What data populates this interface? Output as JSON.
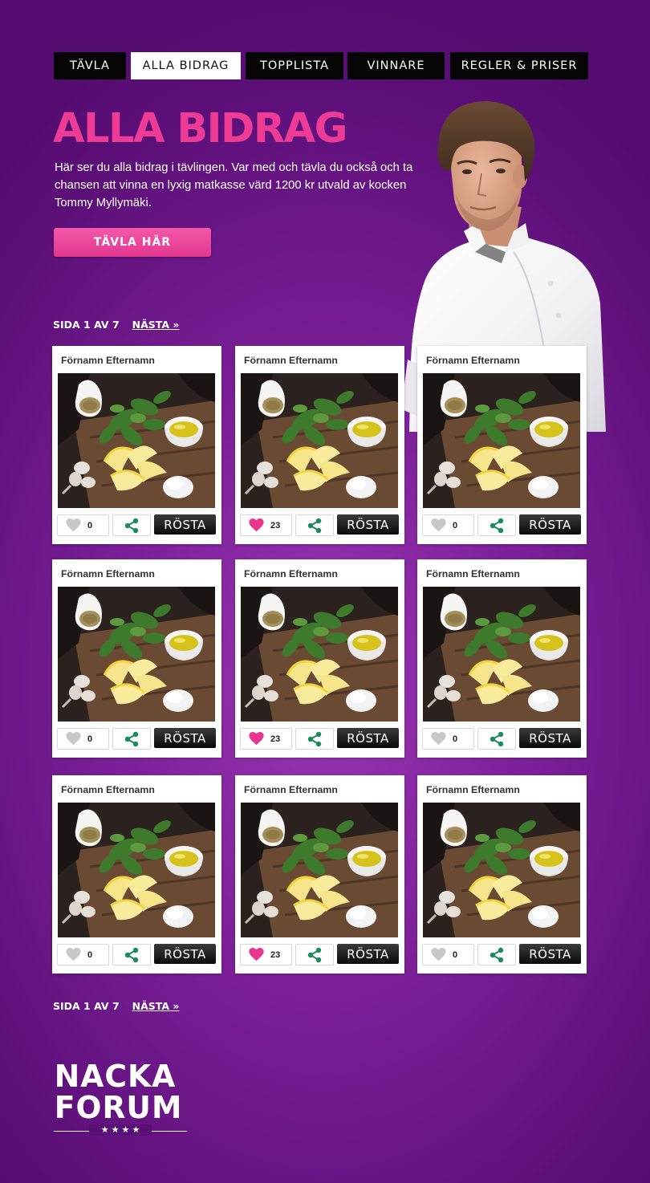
{
  "nav": {
    "tabs": [
      {
        "label": "TÄVLA",
        "active": false
      },
      {
        "label": "ALLA BIDRAG",
        "active": true
      },
      {
        "label": "TOPPLISTA",
        "active": false
      },
      {
        "label": "VINNARE",
        "active": false
      },
      {
        "label": "REGLER & PRISER",
        "active": false
      }
    ]
  },
  "hero": {
    "title": "ALLA BIDRAG",
    "description": "Här ser du alla bidrag i tävlingen. Var med och tävla du också och ta chansen att vinna en lyxig matkasse värd 1200 kr utvald av kocken Tommy Myllymäki.",
    "cta_label": "TÄVLA HÄR"
  },
  "pagination": {
    "page_text": "SIDA 1 AV 7",
    "next_label": "NÄSTA »"
  },
  "entries": [
    {
      "name": "Förnamn Efternamn",
      "likes": "0",
      "liked": false,
      "vote_label": "RÖSTA"
    },
    {
      "name": "Förnamn Efternamn",
      "likes": "23",
      "liked": true,
      "vote_label": "RÖSTA"
    },
    {
      "name": "Förnamn Efternamn",
      "likes": "0",
      "liked": false,
      "vote_label": "RÖSTA"
    },
    {
      "name": "Förnamn Efternamn",
      "likes": "0",
      "liked": false,
      "vote_label": "RÖSTA"
    },
    {
      "name": "Förnamn Efternamn",
      "likes": "23",
      "liked": true,
      "vote_label": "RÖSTA"
    },
    {
      "name": "Förnamn Efternamn",
      "likes": "0",
      "liked": false,
      "vote_label": "RÖSTA"
    },
    {
      "name": "Förnamn Efternamn",
      "likes": "0",
      "liked": false,
      "vote_label": "RÖSTA"
    },
    {
      "name": "Förnamn Efternamn",
      "likes": "23",
      "liked": true,
      "vote_label": "RÖSTA"
    },
    {
      "name": "Förnamn Efternamn",
      "likes": "0",
      "liked": false,
      "vote_label": "RÖSTA"
    }
  ],
  "footer": {
    "logo_line1": "NACKA",
    "logo_line2": "FORUM",
    "logo_stars": "★ ★ ★ ★"
  },
  "colors": {
    "accent_pink": "#ee3c96",
    "liked_heart": "#e8358f",
    "unliked_heart": "#c8c8c8",
    "share_green": "#1c8a5f",
    "background_purple": "#7a1f98"
  },
  "icons": {
    "like": "heart-icon",
    "share": "share-icon"
  }
}
